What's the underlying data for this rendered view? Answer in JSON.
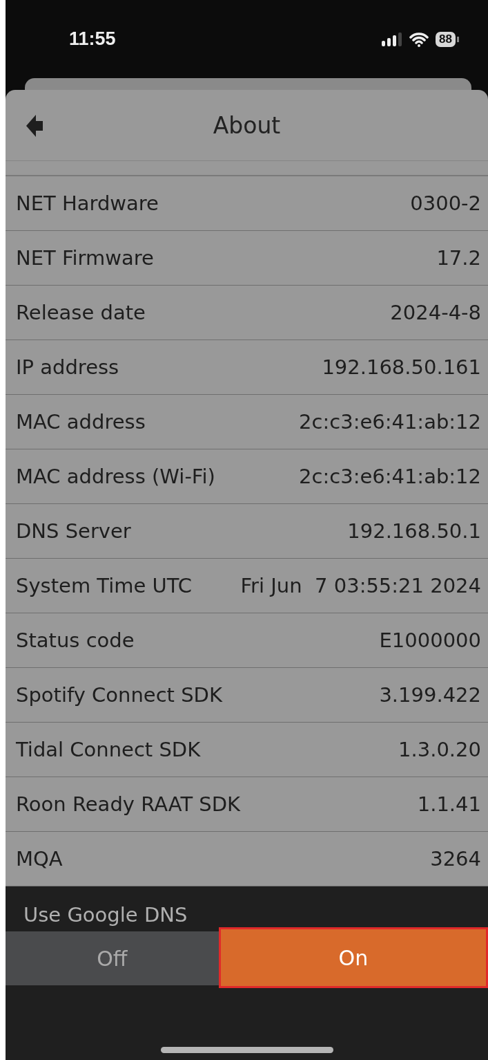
{
  "status_bar": {
    "time": "11:55",
    "battery": "88"
  },
  "header": {
    "title": "About"
  },
  "rows": [
    {
      "label": "NET Hardware",
      "value": "0300-2"
    },
    {
      "label": "NET Firmware",
      "value": "17.2"
    },
    {
      "label": "Release date",
      "value": "2024-4-8"
    },
    {
      "label": "IP address",
      "value": "192.168.50.161"
    },
    {
      "label": "MAC address",
      "value": "2c:c3:e6:41:ab:12"
    },
    {
      "label": "MAC address (Wi-Fi)",
      "value": "2c:c3:e6:41:ab:12"
    },
    {
      "label": "DNS Server",
      "value": "192.168.50.1"
    },
    {
      "label": "System Time UTC",
      "value": "Fri Jun  7 03:55:21 2024"
    },
    {
      "label": "Status code",
      "value": "E1000000"
    },
    {
      "label": "Spotify Connect SDK",
      "value": "3.199.422"
    },
    {
      "label": "Tidal Connect SDK",
      "value": "1.3.0.20"
    },
    {
      "label": "Roon Ready RAAT SDK",
      "value": "1.1.41"
    },
    {
      "label": "MQA",
      "value": "3264"
    }
  ],
  "setting": {
    "label": "Use Google DNS",
    "options": [
      {
        "label": "Off",
        "selected": false
      },
      {
        "label": "On",
        "selected": true
      }
    ]
  }
}
